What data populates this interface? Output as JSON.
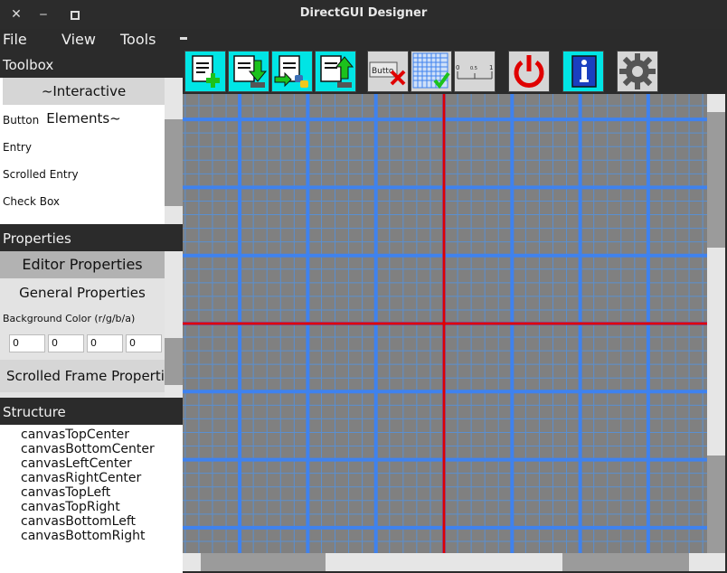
{
  "window": {
    "title": "DirectGUI Designer"
  },
  "menubar": {
    "items": [
      "File",
      "View",
      "Tools"
    ]
  },
  "toolbox": {
    "heading": "Toolbox",
    "category": "~Interactive Elements~",
    "items": [
      "Button",
      "Entry",
      "Scrolled Entry",
      "Check Box"
    ]
  },
  "properties": {
    "heading": "Properties",
    "editor_properties": "Editor Properties",
    "general_properties": "General Properties",
    "bg_color_label": "Background Color (r/g/b/a)",
    "bg_color_values": [
      "0",
      "0",
      "0",
      "0"
    ],
    "scrolled_frame": "Scrolled Frame Properti"
  },
  "structure": {
    "heading": "Structure",
    "items": [
      "canvasTopCenter",
      "canvasBottomCenter",
      "canvasLeftCenter",
      "canvasRightCenter",
      "canvasTopLeft",
      "canvasTopRight",
      "canvasBottomLeft",
      "canvasBottomRight"
    ]
  },
  "toolbar": {
    "tools": [
      "new-file-icon",
      "save-icon",
      "export-python-icon",
      "load-icon",
      "delete-element-icon",
      "toggle-grid-icon",
      "scale-slider-icon",
      "quit-icon",
      "help-icon",
      "settings-icon"
    ],
    "element_button_text": "Butto",
    "scale_ticks": [
      "0",
      "0.5",
      "1"
    ]
  },
  "canvas": {
    "background_color": "#808080",
    "grid_minor_color": "#5a8fd0",
    "grid_major_color": "#3f82ee",
    "axis_color": "#e00000"
  },
  "colors": {
    "titlebar": "#2c2c2c",
    "panel": "#2b2b2b",
    "accent_cyan": "#00e5e5"
  }
}
